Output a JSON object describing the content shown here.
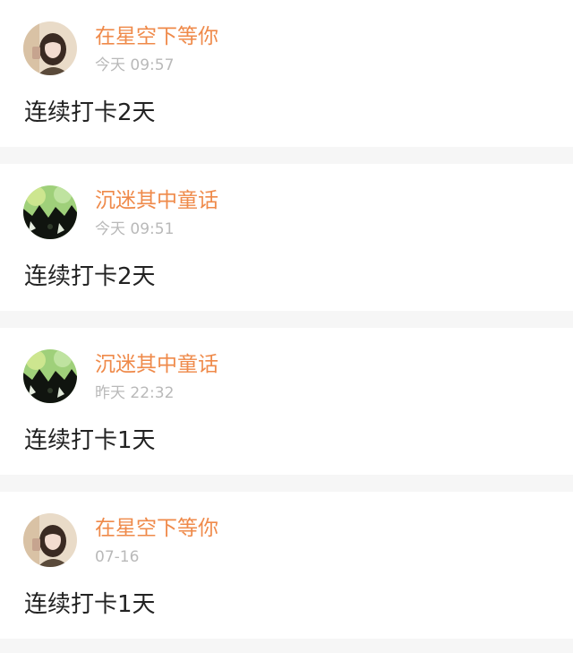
{
  "feed": {
    "posts": [
      {
        "avatar": "user-avatar-photo",
        "username": "在星空下等你",
        "time": "今天 09:57",
        "text": "连续打卡2天"
      },
      {
        "avatar": "user-avatar-forest",
        "username": "沉迷其中童话",
        "time": "今天 09:51",
        "text": "连续打卡2天"
      },
      {
        "avatar": "user-avatar-forest",
        "username": "沉迷其中童话",
        "time": "昨天 22:32",
        "text": "连续打卡1天"
      },
      {
        "avatar": "user-avatar-photo",
        "username": "在星空下等你",
        "time": "07-16",
        "text": "连续打卡1天"
      }
    ]
  },
  "colors": {
    "username": "#ef8a4a",
    "timestamp": "#b9b9b9",
    "text": "#222222",
    "background": "#f6f6f6"
  }
}
